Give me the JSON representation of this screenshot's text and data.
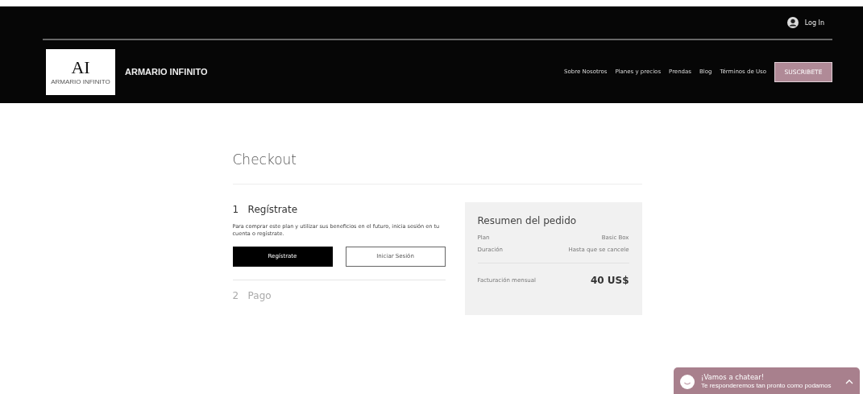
{
  "header": {
    "login": "Log In",
    "logo": {
      "letters": "AI",
      "caption": "ARMARIO INFINITO"
    },
    "site_name": "ARMARIO INFINITO",
    "nav": [
      {
        "label": "Sobre Nosotros"
      },
      {
        "label": "Planes y precios"
      },
      {
        "label": "Prendas"
      },
      {
        "label": "Blog"
      },
      {
        "label": "Términos de Uso"
      }
    ],
    "cta": "SUSCRIBETE"
  },
  "checkout": {
    "title": "Checkout",
    "steps": [
      {
        "number": "1",
        "title": "Regístrate",
        "active": true,
        "text": "Para comprar este plan y utilizar sus beneficios en el futuro, inicia sesión en tu cuenta o regístrate.",
        "buttons": [
          {
            "label": "Regístrate",
            "kind": "primary"
          },
          {
            "label": "Iniciar Sesión",
            "kind": "secondary"
          }
        ]
      },
      {
        "number": "2",
        "title": "Pago",
        "active": false
      }
    ],
    "summary": {
      "title": "Resumen del pedido",
      "rows": [
        {
          "label": "Plan",
          "value": "Basic Box"
        },
        {
          "label": "Duración",
          "value": "Hasta que se cancele"
        }
      ],
      "total_label": "Facturación mensual",
      "total": "40 US$"
    }
  },
  "chat": {
    "title": "¡Vamos a chatear!",
    "subtitle": "Te responderemos tan pronto como podamos"
  }
}
